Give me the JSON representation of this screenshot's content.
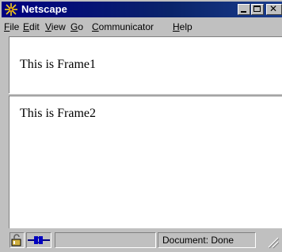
{
  "window": {
    "title": "Netscape"
  },
  "menu": [
    {
      "label": "File",
      "mnemonic": "F",
      "rest": "ile"
    },
    {
      "label": "Edit",
      "mnemonic": "E",
      "rest": "dit"
    },
    {
      "label": "View",
      "mnemonic": "V",
      "rest": "iew"
    },
    {
      "label": "Go",
      "mnemonic": "G",
      "rest": "o"
    },
    {
      "label": "Communicator",
      "mnemonic": "C",
      "rest": "ommunicator"
    },
    {
      "label": "Help",
      "mnemonic": "H",
      "rest": "elp"
    }
  ],
  "frames": {
    "frame1_text": "This is Frame1",
    "frame2_text": "This is Frame2"
  },
  "statusbar": {
    "status_text": "Document: Done"
  },
  "icons": {
    "app": "netscape-star-icon",
    "security": "lock-icon",
    "connection": "plug-icon"
  },
  "colors": {
    "titlebar": "#000080",
    "chrome": "#c0c0c0",
    "content": "#ffffff"
  }
}
